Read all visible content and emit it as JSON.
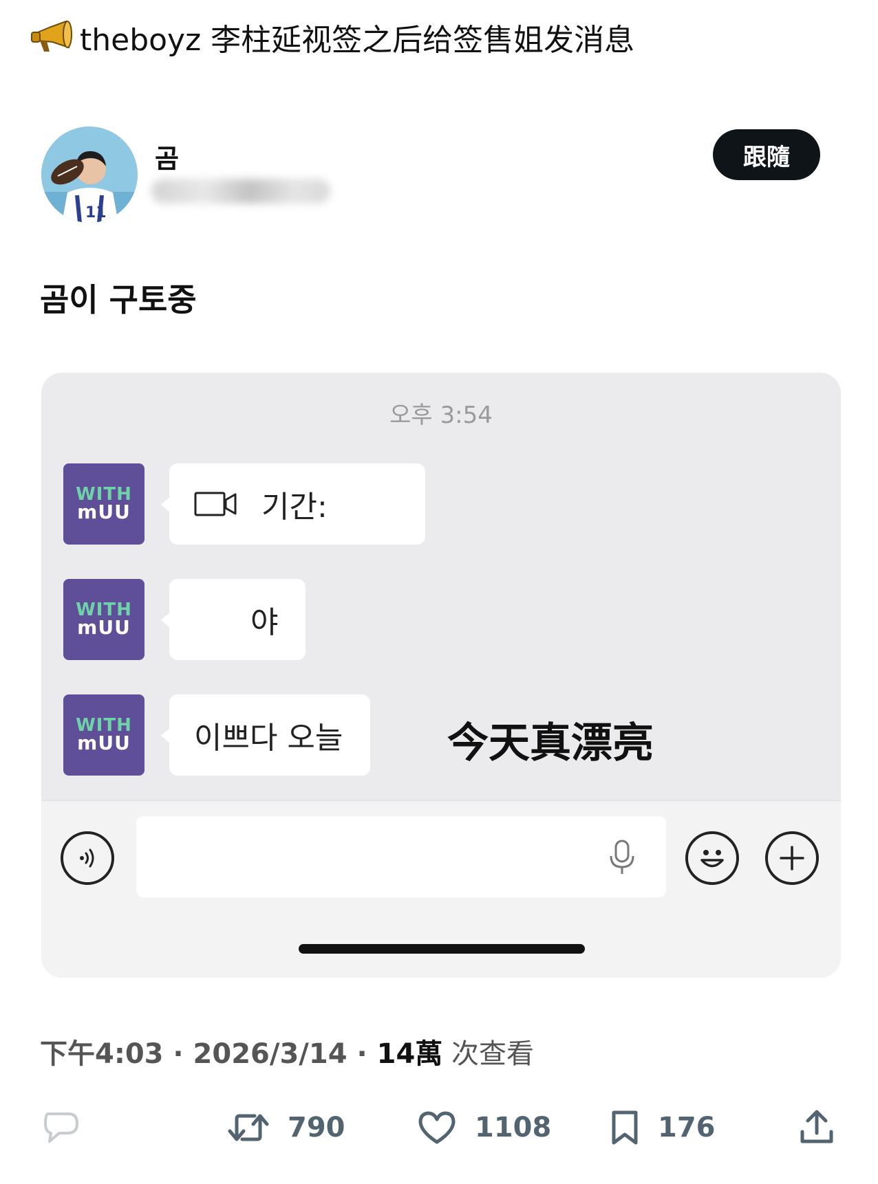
{
  "post": {
    "title": "theboyz 李柱延视签之后给签售姐发消息"
  },
  "tweet": {
    "display_name": "곰",
    "follow_label": "跟隨",
    "text": "곰이 구토중",
    "timestamp": "下午4:03 · 2026/3/14 · ",
    "views_count": "14萬",
    "views_label": " 次查看"
  },
  "chat": {
    "time": "오후 3:54",
    "bot_avatar": {
      "line1": "WITH",
      "line2": "mUU"
    },
    "messages": [
      {
        "text": "기간:",
        "icon": "video-camera-icon"
      },
      {
        "text": "야"
      },
      {
        "text": "이쁘다 오늘"
      }
    ],
    "overlay_caption": "今天真漂亮",
    "input": {
      "placeholder": ""
    }
  },
  "actions": {
    "reply": {
      "icon": "reply-bubble-icon"
    },
    "retweets": {
      "icon": "retweet-icon",
      "count": "790"
    },
    "likes": {
      "icon": "heart-icon",
      "count": "1108"
    },
    "bookmarks": {
      "icon": "bookmark-icon",
      "count": "176"
    },
    "share": {
      "icon": "share-upload-icon"
    }
  },
  "colors": {
    "follow_bg": "#0f1419",
    "chat_bg": "#ebebed",
    "bot_avatar_bg": "#5f4e98",
    "bot_avatar_accent": "#6ed4a8",
    "action_gray": "#536471"
  }
}
